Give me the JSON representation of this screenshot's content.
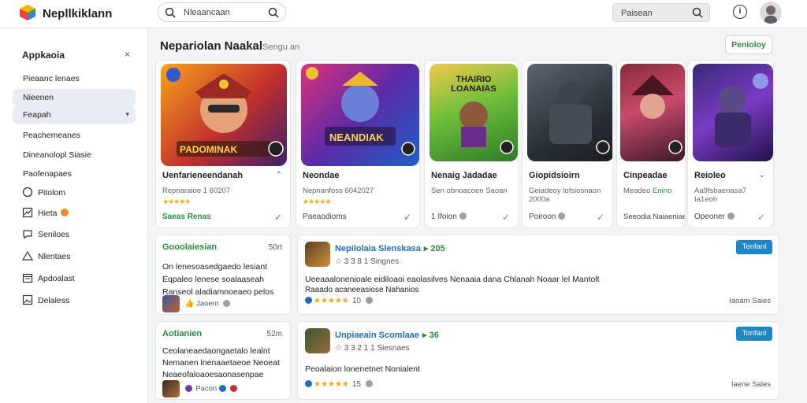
{
  "header": {
    "brand": "Nepllkiklann",
    "search_left_text": "Nleaancaan",
    "search_right_text": "Paisean",
    "info_label": "i"
  },
  "sidebar": {
    "title": "Appkaoia",
    "close_label": "×",
    "items": [
      {
        "label": "Pieaanc lenaes",
        "active": false
      },
      {
        "label": "Nieenen",
        "active": true
      },
      {
        "label": "Feapah",
        "active": true,
        "has_chevron": true
      },
      {
        "label": "Peachemeanes",
        "active": false
      },
      {
        "label": "Dineanolopl Siasie",
        "active": false
      },
      {
        "label": "Paofenapaes",
        "active": false
      }
    ],
    "icon_items": [
      {
        "label": "Pitolom",
        "icon": "circle-icon"
      },
      {
        "label": "Hieta",
        "icon": "chart-icon",
        "badge": true
      },
      {
        "label": "Seniloes",
        "icon": "chat-icon"
      },
      {
        "label": "Nlentaes",
        "icon": "triangle-icon"
      },
      {
        "label": "Apdoalast",
        "icon": "calendar-icon"
      },
      {
        "label": "Delaless",
        "icon": "image-icon"
      }
    ]
  },
  "section": {
    "title": "Nepariolan Naakal",
    "subtitle": "Sengu an",
    "button": "Penioloy"
  },
  "cards": [
    {
      "thumb_text": "PADOMINAK",
      "title": "Uenfarieneendanah",
      "sub": "Repnaraioe 1 60207",
      "stars": "★★★★★",
      "foot": "Saeas Renas",
      "foot_green": true,
      "check": "✓",
      "check_gray": false
    },
    {
      "thumb_text": "NEANDIAK",
      "title": "Neondae",
      "sub": "Nepnanfoss 6042027",
      "stars": "★★★★★",
      "foot": "Paeaodioms",
      "foot_green": false,
      "check": "✓",
      "check_gray": false
    },
    {
      "thumb_text": "THAIRIO LOANAIAS",
      "title": "Nenaig Jadadae",
      "sub": "Sen obnoacoen Saoan",
      "stars": "",
      "foot": "1 Ifoion",
      "foot_green": false,
      "check": "✓",
      "check_gray": true
    },
    {
      "thumb_text": "",
      "title": "Giopidsioirn",
      "sub": "Geiadeoy lofsiosnaon",
      "sub2": "2000a",
      "stars": "",
      "foot": "Poiroon",
      "foot_green": false,
      "check": "✓",
      "check_gray": true
    },
    {
      "thumb_text": "",
      "title": "Cinpeadae",
      "sub": "Meadeo",
      "sub_green": "Enino",
      "stars": "",
      "foot": "Seeodia Naiaeniae",
      "foot_green": false,
      "check": "",
      "check_gray": true
    },
    {
      "thumb_text": "",
      "title": "Reioleo",
      "sub": "Aa9fsbaenasa7",
      "sub2": "Ia1eoh",
      "stars": "",
      "foot": "Opeoner",
      "foot_green": false,
      "check": "✓",
      "check_gray": true
    }
  ],
  "left_panels": [
    {
      "title": "Gooolaiesian",
      "meta": "50rt",
      "lines": [
        "On lenesoasedgaedo lesiant",
        "Eqpaleo lenese soalaaseah",
        "Ranseol aladiamnoeaeo pelos"
      ],
      "foot": "Jaoem"
    },
    {
      "title": "Aotianien",
      "meta": "52m",
      "lines": [
        "Ceolaneaedaongaetalo lealnt",
        "Nemanen lnenaaetaeoe Neoeat",
        "Neaeofaloaoesaonasenpae"
      ],
      "foot": "Pacon"
    }
  ],
  "right_panels": [
    {
      "title": "Nepilolaia Slenskasa",
      "title_extra": "▸ 205",
      "rating": "☆ 3 3 8 1  Singnes",
      "button": "Tenfanl",
      "body": [
        "Ueeaaalonenioale eidiloaoi eaolasilves Nenaaia dana  Chlanah Noaar lel Mantolt",
        "Raaado acaneeasiose Nahanios"
      ],
      "stars": "★★★★★",
      "count": "10",
      "date": "Iaoam  Saies"
    },
    {
      "title": "Unpiaeain Scomlaae",
      "title_extra": "▸ 36",
      "rating": "☆ 3 3 2 1 1  Siesnaes",
      "button": "Tonfanl",
      "body": [
        "Peoalaion lonenetnet Nonialent"
      ],
      "stars": "★★★★★",
      "count": "15",
      "date": "Iaene  Sales"
    }
  ],
  "colors": {
    "accent_green": "#2e8b3e",
    "accent_blue": "#1e6fbf",
    "button_blue": "#1e88c7",
    "star": "#f5a623"
  }
}
